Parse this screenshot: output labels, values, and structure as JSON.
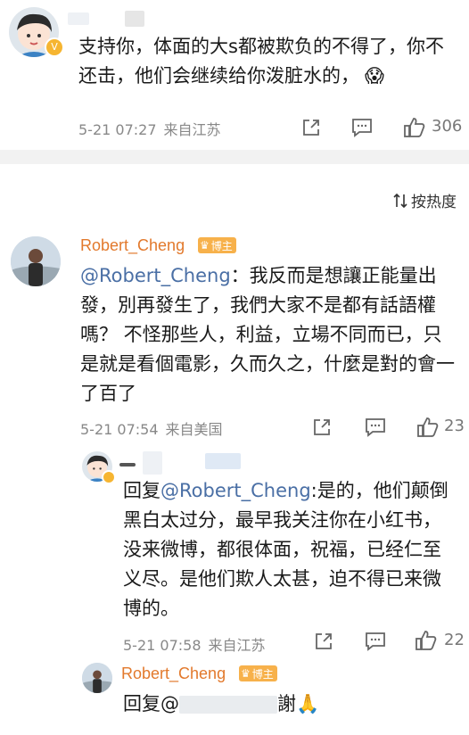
{
  "comment1": {
    "text": "支持你，体面的大s都被欺负的不得了，你不还击，他们会继续给你泼脏水的，",
    "emoji": "😱",
    "time": "5-21 07:27",
    "location": "来自江苏",
    "likes": "306"
  },
  "sort": {
    "label": "按热度"
  },
  "comment2": {
    "username": "Robert_Cheng",
    "badge": "博主",
    "mention": "@Robert_Cheng",
    "text": "：我反而是想讓正能量出發，別再發生了，我們大家不是都有話語權嗎？ 不怪那些人，利益，立場不同而已，只是就是看個電影，久而久之，什麼是對的會一了百了",
    "time": "5-21 07:54",
    "location": "来自美国",
    "likes": "23"
  },
  "reply1": {
    "prefix": "回复",
    "mention": "@Robert_Cheng",
    "text": ":是的，他们颠倒黑白太过分，最早我关注你在小红书，没来微博，都很体面，祝福，已经仁至义尽。是他们欺人太甚，迫不得已来微博的。",
    "time": "5-21 07:58",
    "location": "来自江苏",
    "likes": "22"
  },
  "reply2": {
    "username": "Robert_Cheng",
    "badge": "博主",
    "prefix": "回复@",
    "suffix": "謝",
    "emoji": "🙏"
  },
  "colors": {
    "username": "#e2792c",
    "mention": "#4a6fa5",
    "badge": "#f7b14b",
    "meta": "#888888"
  }
}
